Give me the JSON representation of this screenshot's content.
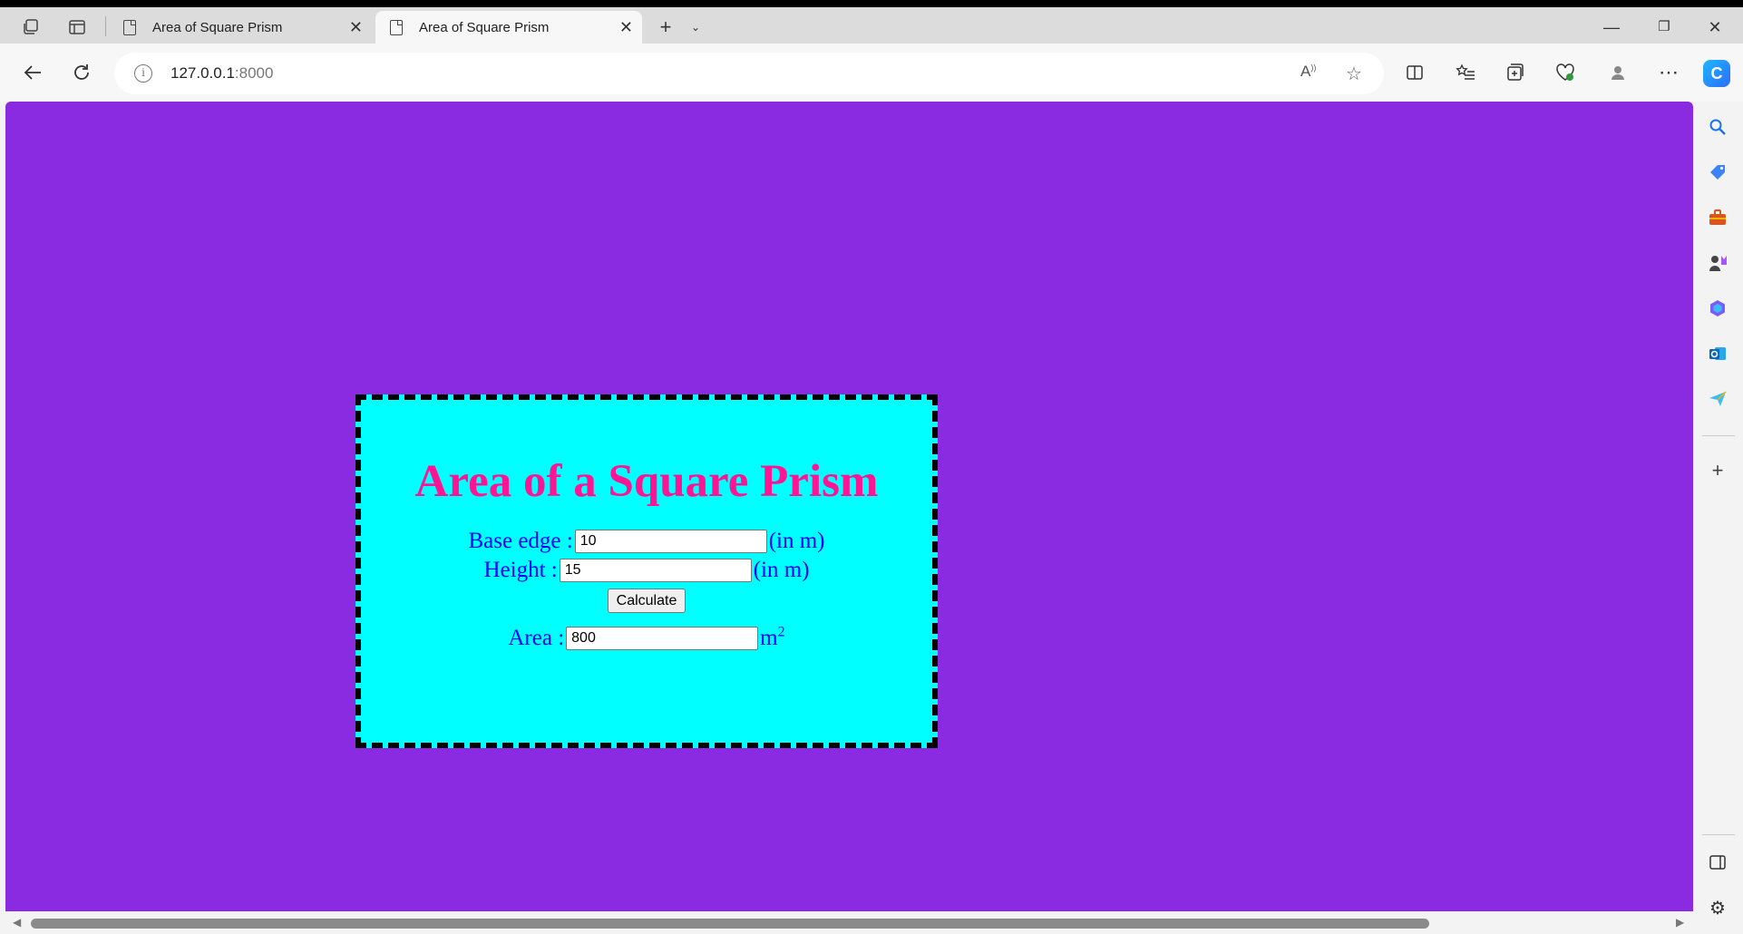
{
  "browser": {
    "tabs": [
      {
        "title": "Area of Square Prism",
        "active": false
      },
      {
        "title": "Area of Square Prism",
        "active": true
      }
    ],
    "url_host": "127.0.0.1",
    "url_port": ":8000"
  },
  "page": {
    "background": "#8a2be2",
    "card_background": "#00ffff",
    "title": "Area of a Square Prism",
    "title_color": "#ff1493",
    "label_color": "#0000ff",
    "base_edge": {
      "label": "Base edge :",
      "value": "10",
      "unit": "(in m)"
    },
    "height": {
      "label": "Height :",
      "value": "15",
      "unit": "(in m)"
    },
    "calculate_label": "Calculate",
    "area": {
      "label": "Area :",
      "value": "800",
      "unit": "m",
      "unit_sup": "2"
    }
  },
  "icons": {
    "tab_actions": "tab-actions-icon",
    "vertical_tabs": "vertical-tabs-icon",
    "new_tab": "plus-icon",
    "tab_list": "chevron-down-icon",
    "back": "back-arrow-icon",
    "refresh": "refresh-icon",
    "site_info": "info-icon",
    "read_aloud": "read-aloud-icon",
    "favorite": "star-icon"
  }
}
